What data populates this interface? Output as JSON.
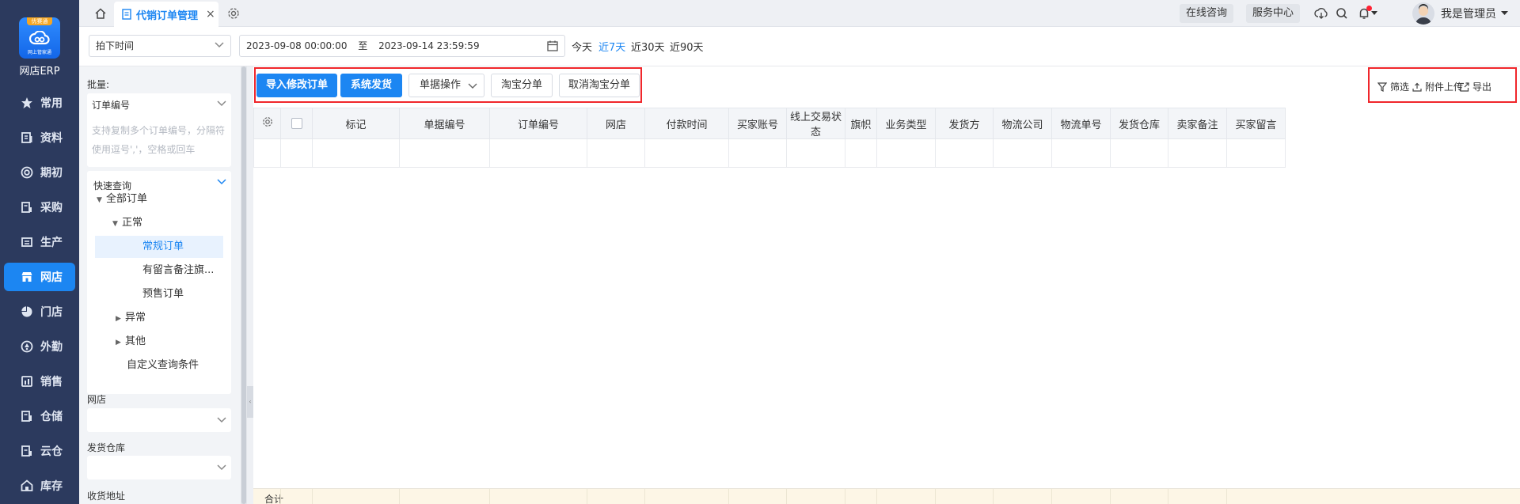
{
  "app": {
    "logo_ribbon": "优赛通",
    "logo_sub": "网上管家通",
    "name": "网店ERP"
  },
  "nav": [
    {
      "label": "常用",
      "icon": "star-icon"
    },
    {
      "label": "资料",
      "icon": "document-icon"
    },
    {
      "label": "期初",
      "icon": "target-icon"
    },
    {
      "label": "采购",
      "icon": "purchase-icon"
    },
    {
      "label": "生产",
      "icon": "production-icon"
    },
    {
      "label": "网店",
      "icon": "shop-icon",
      "active": true
    },
    {
      "label": "门店",
      "icon": "store-icon"
    },
    {
      "label": "外勤",
      "icon": "field-icon"
    },
    {
      "label": "销售",
      "icon": "sales-icon"
    },
    {
      "label": "仓储",
      "icon": "warehouse-icon"
    },
    {
      "label": "云仓",
      "icon": "cloud-warehouse-icon"
    },
    {
      "label": "库存",
      "icon": "inventory-icon"
    }
  ],
  "topbar": {
    "tab_label": "代销订单管理",
    "tab_close": "×",
    "online_consult": "在线咨询",
    "service_center": "服务中心",
    "username": "我是管理员"
  },
  "filter": {
    "time_field": "拍下时间",
    "date_start": "2023-09-08 00:00:00",
    "date_sep": "至",
    "date_end": "2023-09-14 23:59:59",
    "quick": [
      "今天",
      "近7天",
      "近30天",
      "近90天"
    ],
    "quick_active_index": 1
  },
  "sidepanel": {
    "batch_label": "批量:",
    "batch_field": "订单编号",
    "batch_hint_line1": "支持复制多个订单编号，分隔符",
    "batch_hint_line2": "使用逗号','，空格或回车",
    "quick_query": "快速查询",
    "tree": {
      "all_orders": "全部订单",
      "normal": "正常",
      "regular": "常规订单",
      "with_notes": "有留言备注旗...",
      "presale": "预售订单",
      "abnormal": "异常",
      "other": "其他",
      "custom": "自定义查询条件"
    },
    "shop_label": "网店",
    "warehouse_label": "发货仓库",
    "address_label": "收货地址"
  },
  "toolbar": {
    "import_modify": "导入修改订单",
    "system_ship": "系统发货",
    "doc_ops": "单据操作",
    "taobao_split": "淘宝分单",
    "cancel_taobao_split": "取消淘宝分单",
    "filter": "筛选",
    "attach_upload": "附件上传",
    "export": "导出"
  },
  "table": {
    "columns": [
      "标记",
      "单据编号",
      "订单编号",
      "网店",
      "付款时间",
      "买家账号",
      "线上交易状态",
      "旗帜",
      "业务类型",
      "发货方",
      "物流公司",
      "物流单号",
      "发货仓库",
      "卖家备注",
      "买家留言"
    ],
    "footer_label": "合计"
  },
  "colors": {
    "accent": "#1c86f2",
    "nav_bg": "#2c3a5e",
    "highlight_border": "#f0262b"
  }
}
